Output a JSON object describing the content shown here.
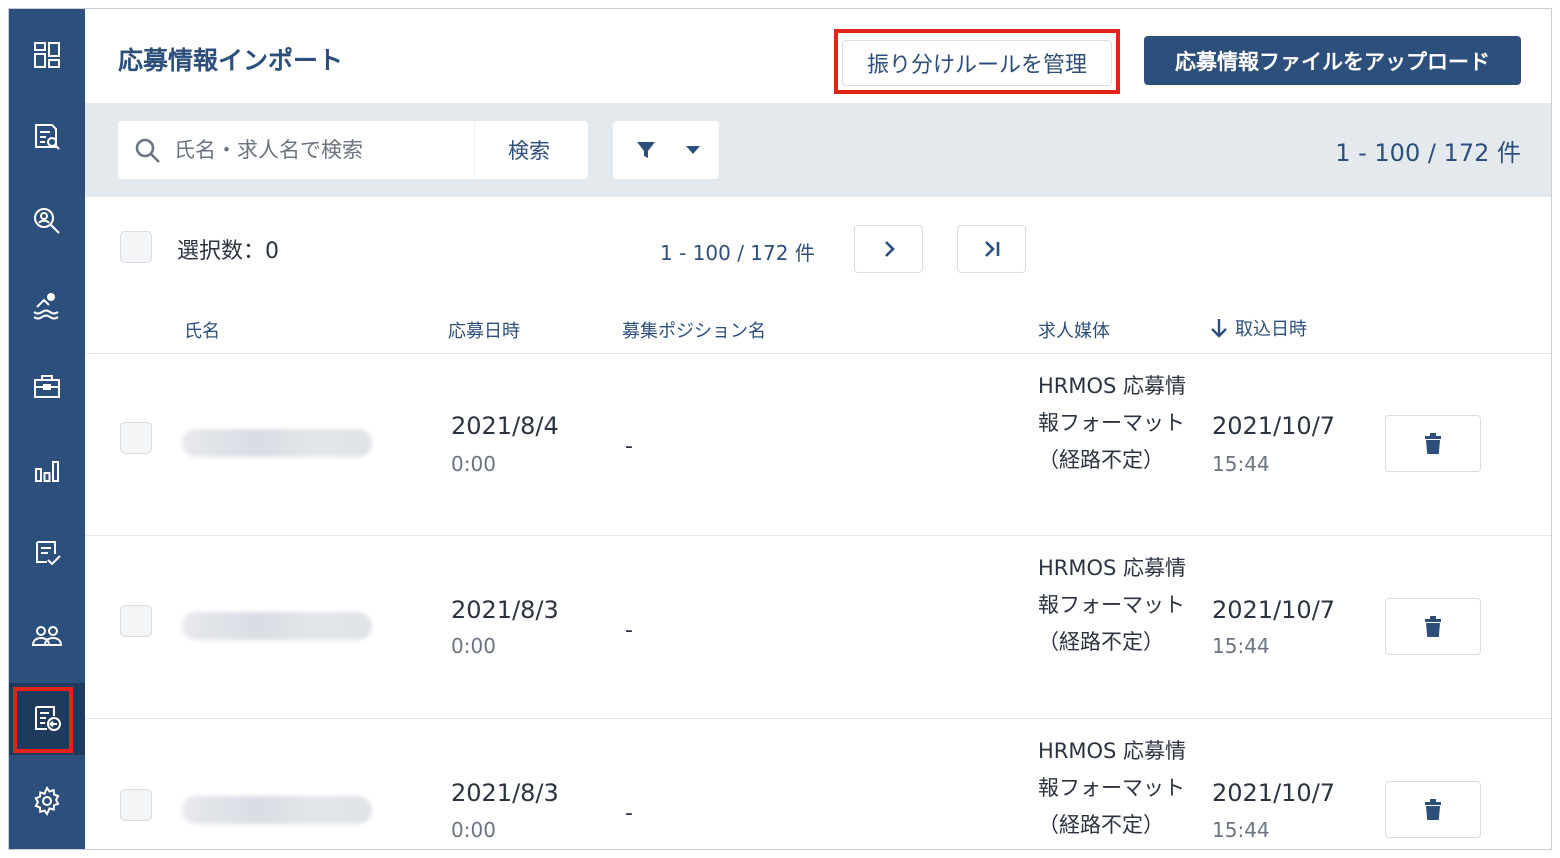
{
  "header": {
    "title": "応募情報インポート",
    "rules_button": "振り分けルールを管理",
    "upload_button": "応募情報ファイルをアップロード"
  },
  "toolbar": {
    "search_placeholder": "氏名・求人名で検索",
    "search_button": "検索",
    "count": "1 - 100 / 172 件"
  },
  "pager": {
    "selected": "選択数：0",
    "range": "1 - 100 / 172 件"
  },
  "columns": {
    "name": "氏名",
    "applied": "応募日時",
    "position": "募集ポジション名",
    "media": "求人媒体",
    "imported": "取込日時"
  },
  "rows": [
    {
      "date": "2021/8/4",
      "time": "0:00",
      "position": "-",
      "media": "HRMOS 応募情報フォーマット（経路不定）",
      "import_date": "2021/10/7",
      "import_time": "15:44"
    },
    {
      "date": "2021/8/3",
      "time": "0:00",
      "position": "-",
      "media": "HRMOS 応募情報フォーマット（経路不定）",
      "import_date": "2021/10/7",
      "import_time": "15:44"
    },
    {
      "date": "2021/8/3",
      "time": "0:00",
      "position": "-",
      "media": "HRMOS 応募情報フォーマット（経路不定）",
      "import_date": "2021/10/7",
      "import_time": "15:44"
    }
  ],
  "sidebar": {
    "items": [
      {
        "icon": "dashboard-icon"
      },
      {
        "icon": "document-search-icon"
      },
      {
        "icon": "candidate-search-icon"
      },
      {
        "icon": "swimmer-icon"
      },
      {
        "icon": "briefcase-icon"
      },
      {
        "icon": "bar-chart-icon"
      },
      {
        "icon": "checklist-icon"
      },
      {
        "icon": "users-icon"
      },
      {
        "icon": "import-icon",
        "active": true
      },
      {
        "icon": "gear-icon"
      }
    ]
  },
  "colors": {
    "sidebar": "#2d4f7c",
    "accent": "#2d4f7c",
    "highlight": "#e4231b",
    "toolbar_bg": "#e4e9ee"
  }
}
